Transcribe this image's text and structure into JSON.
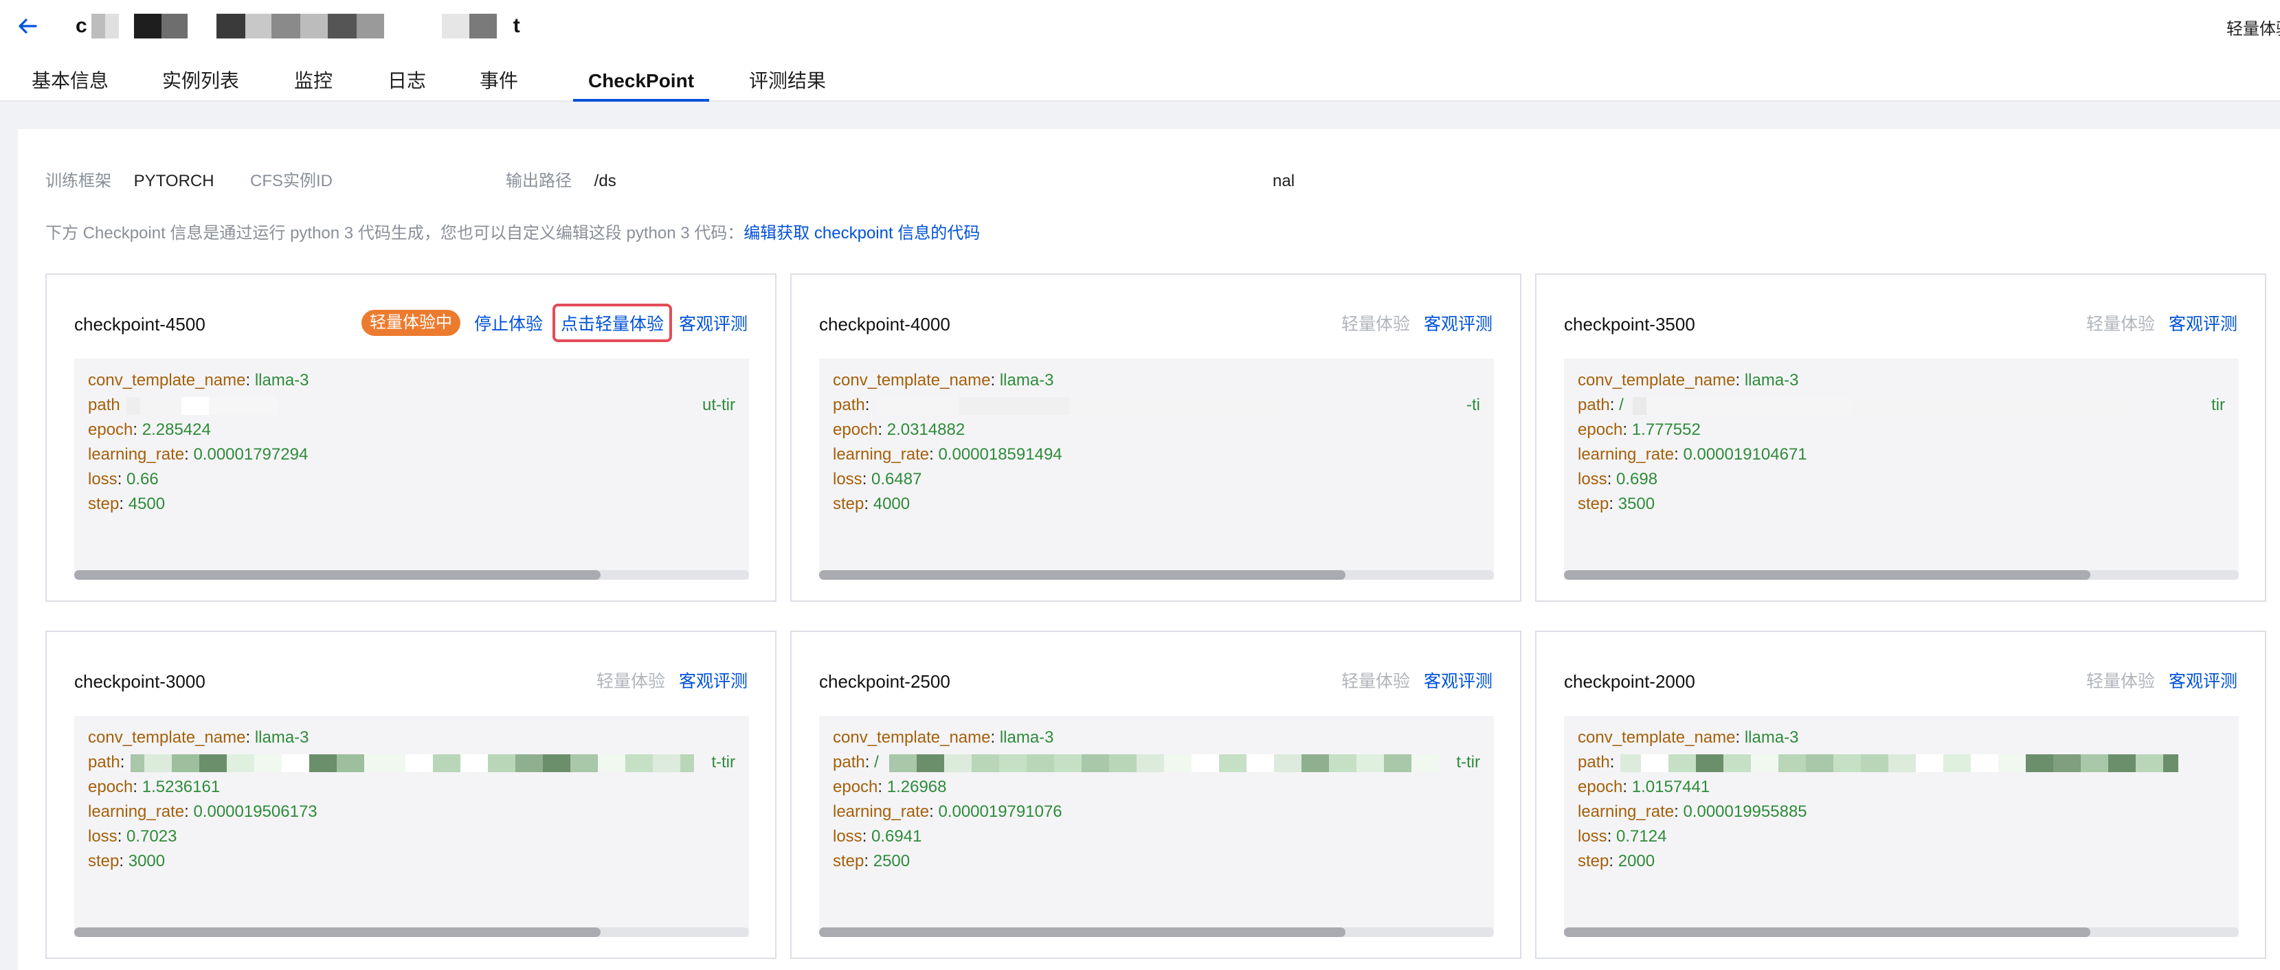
{
  "header": {
    "title_chars": [
      "c",
      "t"
    ],
    "right_label": "轻量体验",
    "tabs": [
      {
        "label": "基本信息",
        "active": false
      },
      {
        "label": "实例列表",
        "active": false
      },
      {
        "label": "监控",
        "active": false
      },
      {
        "label": "日志",
        "active": false
      },
      {
        "label": "事件",
        "active": false
      },
      {
        "label": "CheckPoint",
        "active": true
      },
      {
        "label": "评测结果",
        "active": false
      }
    ]
  },
  "meta": {
    "framework_key": "训练框架",
    "framework_val": "PYTORCH",
    "cfs_key": "CFS实例ID",
    "output_key": "输出路径",
    "output_val_prefix": "/ds",
    "output_val_suffix": "nal"
  },
  "hint": {
    "text": "下方 Checkpoint 信息是通过运行 python 3 代码生成，您也可以自定义编辑这段 python 3 代码：",
    "link": "编辑获取 checkpoint 信息的代码"
  },
  "colors": {
    "accent": "#0052d9",
    "badge": "#ed7b2f",
    "highlight": "#e34d59",
    "key": "#a5600a",
    "value": "#2e8b3a"
  },
  "cards": [
    {
      "title": "checkpoint-4500",
      "actions": {
        "badge": "轻量体验中",
        "stop": "停止体验",
        "try": "点击轻量体验",
        "eval": "客观评测"
      },
      "fields": {
        "conv_key": "conv_template_name",
        "conv_val": "llama-3",
        "path_key": "path",
        "path_prefix": "",
        "path_tail": "ut-tir",
        "epoch_key": "epoch",
        "epoch_val": "2.285424",
        "lr_key": "learning_rate",
        "lr_val": "0.00001797294",
        "loss_key": "loss",
        "loss_val": "0.66",
        "step_key": "step",
        "step_val": "4500"
      },
      "scroll_fraction": 0.78
    },
    {
      "title": "checkpoint-4000",
      "actions": {
        "try": "轻量体验",
        "eval": "客观评测"
      },
      "fields": {
        "conv_key": "conv_template_name",
        "conv_val": "llama-3",
        "path_key": "path",
        "path_prefix": "",
        "path_tail": "-ti",
        "epoch_key": "epoch",
        "epoch_val": "2.0314882",
        "lr_key": "learning_rate",
        "lr_val": "0.000018591494",
        "loss_key": "loss",
        "loss_val": "0.6487",
        "step_key": "step",
        "step_val": "4000"
      },
      "scroll_fraction": 0.78
    },
    {
      "title": "checkpoint-3500",
      "actions": {
        "try": "轻量体验",
        "eval": "客观评测"
      },
      "fields": {
        "conv_key": "conv_template_name",
        "conv_val": "llama-3",
        "path_key": "path",
        "path_prefix": "/",
        "path_tail": "tir",
        "epoch_key": "epoch",
        "epoch_val": "1.777552",
        "lr_key": "learning_rate",
        "lr_val": "0.000019104671",
        "loss_key": "loss",
        "loss_val": "0.698",
        "step_key": "step",
        "step_val": "3500"
      },
      "scroll_fraction": 0.78
    },
    {
      "title": "checkpoint-3000",
      "actions": {
        "try": "轻量体验",
        "eval": "客观评测"
      },
      "fields": {
        "conv_key": "conv_template_name",
        "conv_val": "llama-3",
        "path_key": "path",
        "path_prefix": "",
        "path_tail": "t-tir",
        "epoch_key": "epoch",
        "epoch_val": "1.5236161",
        "lr_key": "learning_rate",
        "lr_val": "0.000019506173",
        "loss_key": "loss",
        "loss_val": "0.7023",
        "step_key": "step",
        "step_val": "3000"
      },
      "scroll_fraction": 0.78
    },
    {
      "title": "checkpoint-2500",
      "actions": {
        "try": "轻量体验",
        "eval": "客观评测"
      },
      "fields": {
        "conv_key": "conv_template_name",
        "conv_val": "llama-3",
        "path_key": "path",
        "path_prefix": "/",
        "path_tail": "t-tir",
        "epoch_key": "epoch",
        "epoch_val": "1.26968",
        "lr_key": "learning_rate",
        "lr_val": "0.000019791076",
        "loss_key": "loss",
        "loss_val": "0.6941",
        "step_key": "step",
        "step_val": "2500"
      },
      "scroll_fraction": 0.78
    },
    {
      "title": "checkpoint-2000",
      "actions": {
        "try": "轻量体验",
        "eval": "客观评测"
      },
      "fields": {
        "conv_key": "conv_template_name",
        "conv_val": "llama-3",
        "path_key": "path",
        "path_prefix": "",
        "path_tail": "",
        "epoch_key": "epoch",
        "epoch_val": "1.0157441",
        "lr_key": "learning_rate",
        "lr_val": "0.000019955885",
        "loss_key": "loss",
        "loss_val": "0.7124",
        "step_key": "step",
        "step_val": "2000"
      },
      "scroll_fraction": 0.78
    }
  ]
}
